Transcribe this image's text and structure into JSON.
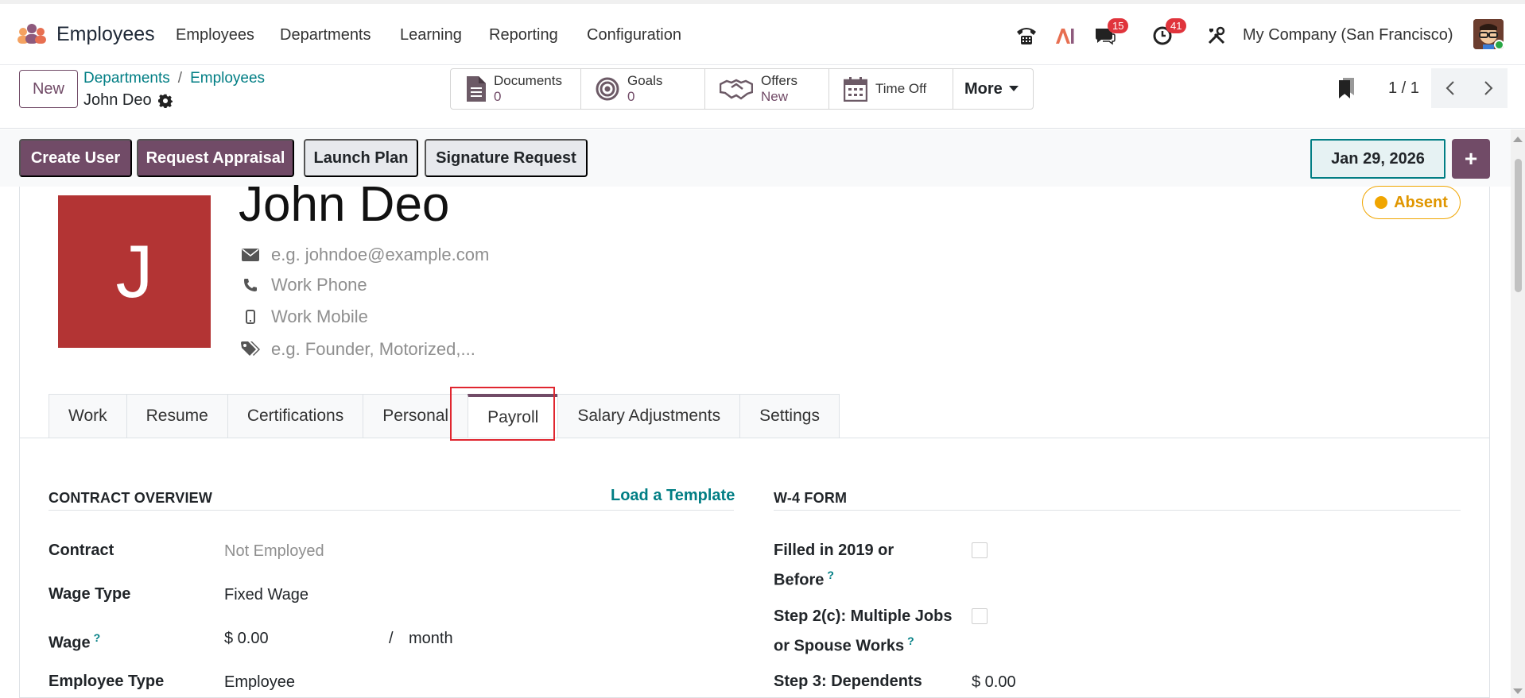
{
  "topbar": {
    "app_name": "Employees",
    "nav": [
      "Employees",
      "Departments",
      "Learning",
      "Reporting",
      "Configuration"
    ],
    "messages_count": "15",
    "activities_count": "41",
    "company": "My Company (San Francisco)"
  },
  "control": {
    "new_label": "New",
    "breadcrumb": [
      "Departments",
      "Employees"
    ],
    "current_record": "John Deo",
    "smart_buttons": [
      {
        "label": "Documents",
        "value": "0",
        "icon": "document-icon"
      },
      {
        "label": "Goals",
        "value": "0",
        "icon": "target-icon"
      },
      {
        "label": "Offers",
        "value": "New",
        "icon": "handshake-icon"
      },
      {
        "label": "Time Off",
        "value": "",
        "icon": "calendar-icon"
      }
    ],
    "more_label": "More",
    "pager": "1 / 1"
  },
  "actions": {
    "create_user": "Create User",
    "request_appraisal": "Request Appraisal",
    "launch_plan": "Launch Plan",
    "signature_request": "Signature Request",
    "date": "Jan 29, 2026",
    "plus": "+"
  },
  "employee": {
    "initial": "J",
    "name": "John Deo",
    "email_placeholder": "e.g. johndoe@example.com",
    "work_phone_placeholder": "Work Phone",
    "work_mobile_placeholder": "Work Mobile",
    "tags_placeholder": "e.g. Founder, Motorized,...",
    "status": "Absent"
  },
  "tabs": [
    "Work",
    "Resume",
    "Certifications",
    "Personal",
    "Payroll",
    "Salary Adjustments",
    "Settings"
  ],
  "active_tab": "Payroll",
  "contract_overview": {
    "title": "CONTRACT OVERVIEW",
    "load_template": "Load a Template",
    "fields": [
      {
        "label": "Contract",
        "value": "Not Employed"
      },
      {
        "label": "Wage Type",
        "value": "Fixed Wage"
      },
      {
        "label": "Wage",
        "value": "$ 0.00",
        "unit_sep": "/",
        "unit": "month"
      },
      {
        "label": "Employee Type",
        "value": "Employee"
      }
    ]
  },
  "w4_form": {
    "title": "W-4 FORM",
    "filled_2019_line1": "Filled in 2019 or",
    "filled_2019_line2": "Before",
    "step2c_line1": "Step 2(c): Multiple Jobs",
    "step2c_line2": "or Spouse Works",
    "step3_label": "Step 3: Dependents",
    "step3_value": "$ 0.00"
  },
  "colors": {
    "primary": "#714b67",
    "link": "#017e84",
    "avatar_bg": "#b33434",
    "status": "#f0a500"
  }
}
